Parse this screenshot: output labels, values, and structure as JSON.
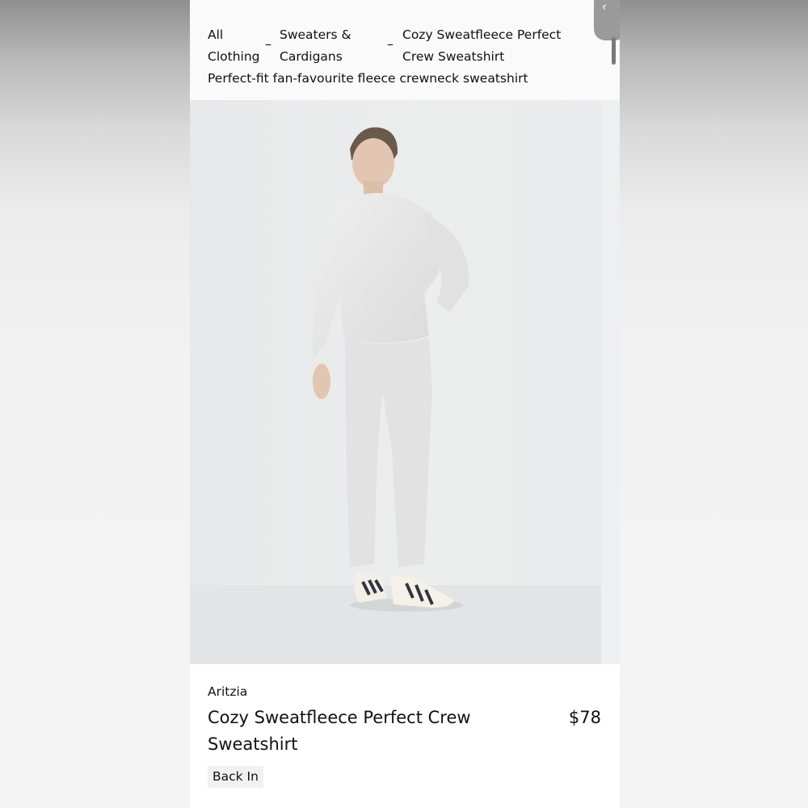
{
  "breadcrumb": {
    "items": [
      {
        "label": "All Clothing"
      },
      {
        "label": "Sweaters & Cardigans"
      },
      {
        "label": "Cozy Sweatfleece Perfect Crew Sweatshirt"
      }
    ],
    "separator": "–"
  },
  "product": {
    "tagline": "Perfect-fit fan-favourite fleece crewneck sweatshirt",
    "brand": "Aritzia",
    "title": "Cozy Sweatfleece Perfect Crew Sweatshirt",
    "price": "$78",
    "badge": "Back In",
    "image": {
      "background": "#e9eaeb",
      "garment_color": "#e8e8e8",
      "shoe_stripe_color": "#2f3540"
    }
  },
  "icons": {
    "corner": "back-arrow-icon"
  }
}
